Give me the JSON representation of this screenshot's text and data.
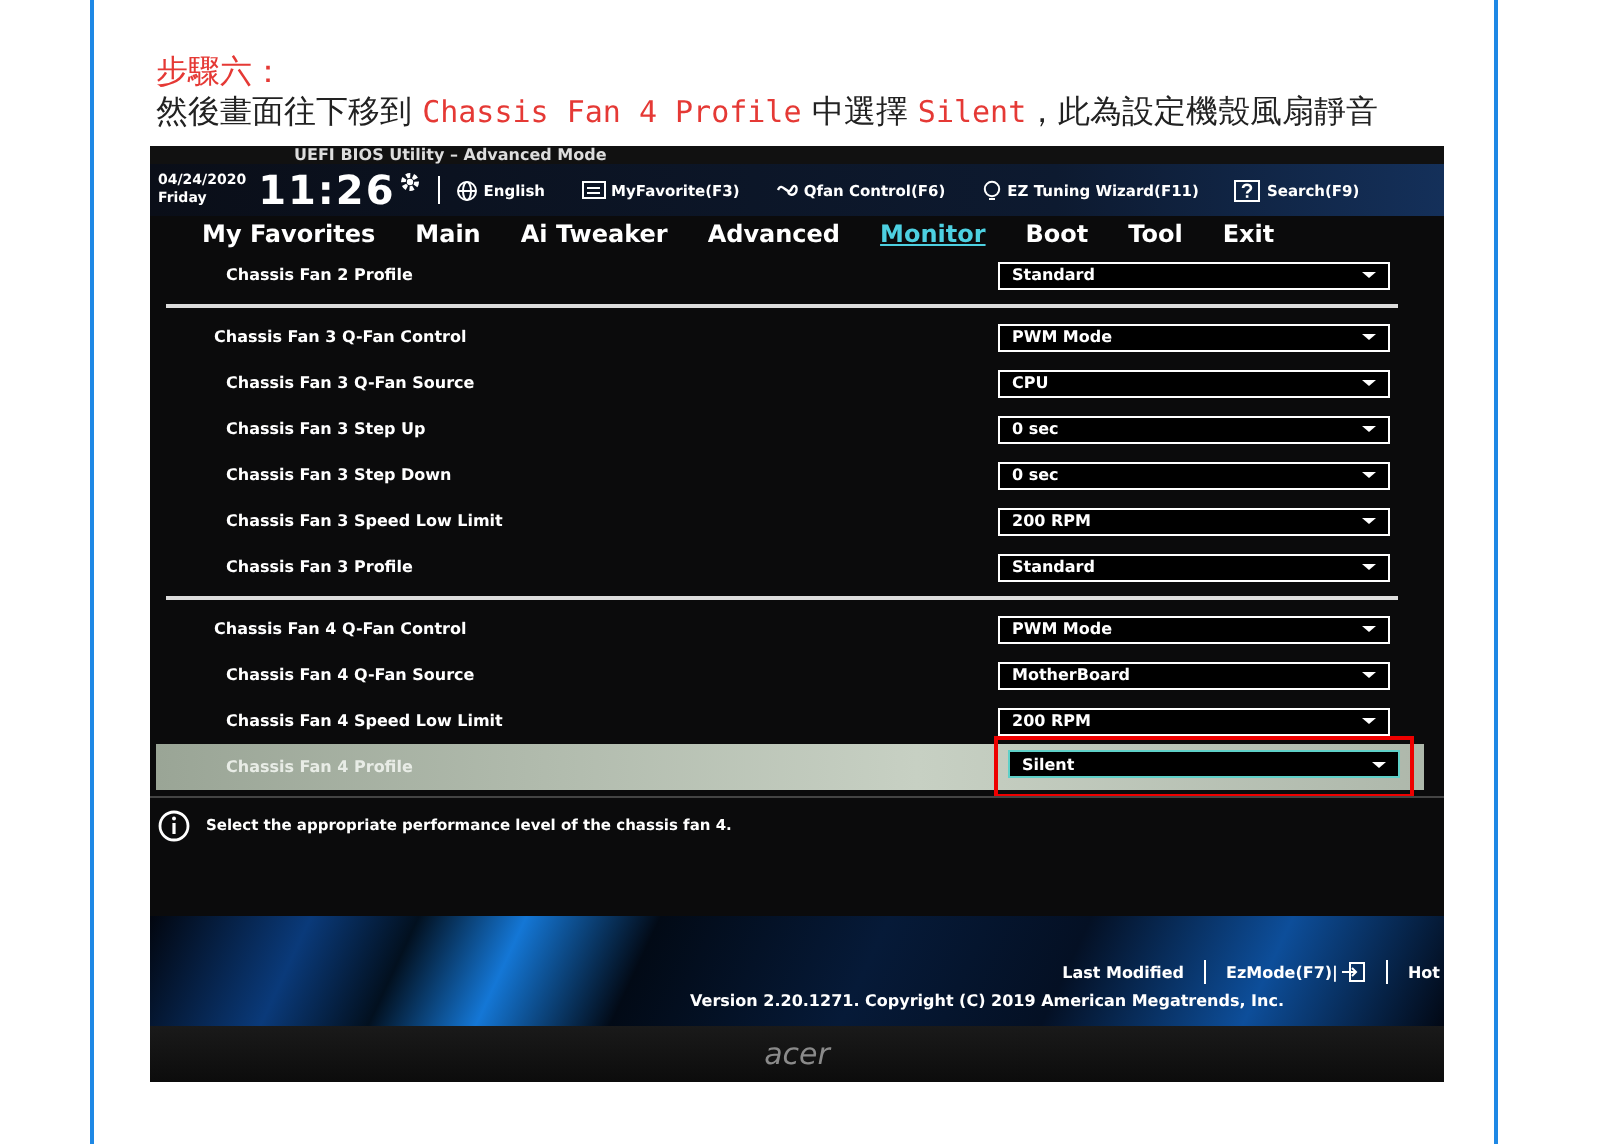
{
  "step_title": "步驟六：",
  "instruction": [
    {
      "text": "然後畫面往下移到 ",
      "highlight": false
    },
    {
      "text": "Chassis Fan 4 Profile",
      "highlight": true
    },
    {
      "text": " 中選擇 ",
      "highlight": false
    },
    {
      "text": "Silent",
      "highlight": true
    },
    {
      "text": "，此為設定機殼風扇靜音",
      "highlight": false
    }
  ],
  "bios": {
    "title": "UEFI BIOS Utility – Advanced Mode",
    "date": "04/24/2020",
    "day": "Friday",
    "time": "11:26",
    "toolbar": [
      {
        "kind": "globe",
        "label": "English"
      },
      {
        "kind": "card",
        "label": "MyFavorite(F3)"
      },
      {
        "kind": "fan",
        "label": "Qfan Control(F6)"
      },
      {
        "kind": "bulb",
        "label": "EZ Tuning Wizard(F11)"
      },
      {
        "kind": "help",
        "label": "Search(F9)"
      }
    ],
    "tabs": [
      {
        "label": "My Favorites",
        "selected": false
      },
      {
        "label": "Main",
        "selected": false
      },
      {
        "label": "Ai Tweaker",
        "selected": false
      },
      {
        "label": "Advanced",
        "selected": false
      },
      {
        "label": "Monitor",
        "selected": true
      },
      {
        "label": "Boot",
        "selected": false
      },
      {
        "label": "Tool",
        "selected": false
      },
      {
        "label": "Exit",
        "selected": false
      }
    ],
    "groups": [
      {
        "children": [
          {
            "label": "Chassis Fan 2 Profile",
            "value": "Standard",
            "selected": false,
            "annotated": false
          }
        ]
      },
      {
        "label": "Chassis Fan 3 Q-Fan Control",
        "value": "PWM Mode",
        "selected": false,
        "annotated": false,
        "children": [
          {
            "label": "Chassis Fan 3 Q-Fan Source",
            "value": "CPU",
            "selected": false,
            "annotated": false
          },
          {
            "label": "Chassis Fan 3 Step Up",
            "value": "0 sec",
            "selected": false,
            "annotated": false
          },
          {
            "label": "Chassis Fan 3 Step Down",
            "value": "0 sec",
            "selected": false,
            "annotated": false
          },
          {
            "label": "Chassis Fan 3 Speed Low Limit",
            "value": "200 RPM",
            "selected": false,
            "annotated": false
          },
          {
            "label": "Chassis Fan 3 Profile",
            "value": "Standard",
            "selected": false,
            "annotated": false
          }
        ]
      },
      {
        "label": "Chassis Fan 4 Q-Fan Control",
        "value": "PWM Mode",
        "selected": false,
        "annotated": false,
        "children": [
          {
            "label": "Chassis Fan 4 Q-Fan Source",
            "value": "MotherBoard",
            "selected": false,
            "annotated": false
          },
          {
            "label": "Chassis Fan 4 Speed Low Limit",
            "value": "200 RPM",
            "selected": false,
            "annotated": false
          },
          {
            "label": "Chassis Fan 4 Profile",
            "value": "Silent",
            "selected": true,
            "annotated": true
          }
        ]
      }
    ],
    "help_text": "Select the appropriate performance level of the chassis fan 4.",
    "footer_links": [
      "Last Modified",
      "EzMode(F7)|",
      "Hot"
    ],
    "version": "Version 2.20.1271. Copyright (C) 2019 American Megatrends, Inc.",
    "monitor_brand": "acer"
  }
}
